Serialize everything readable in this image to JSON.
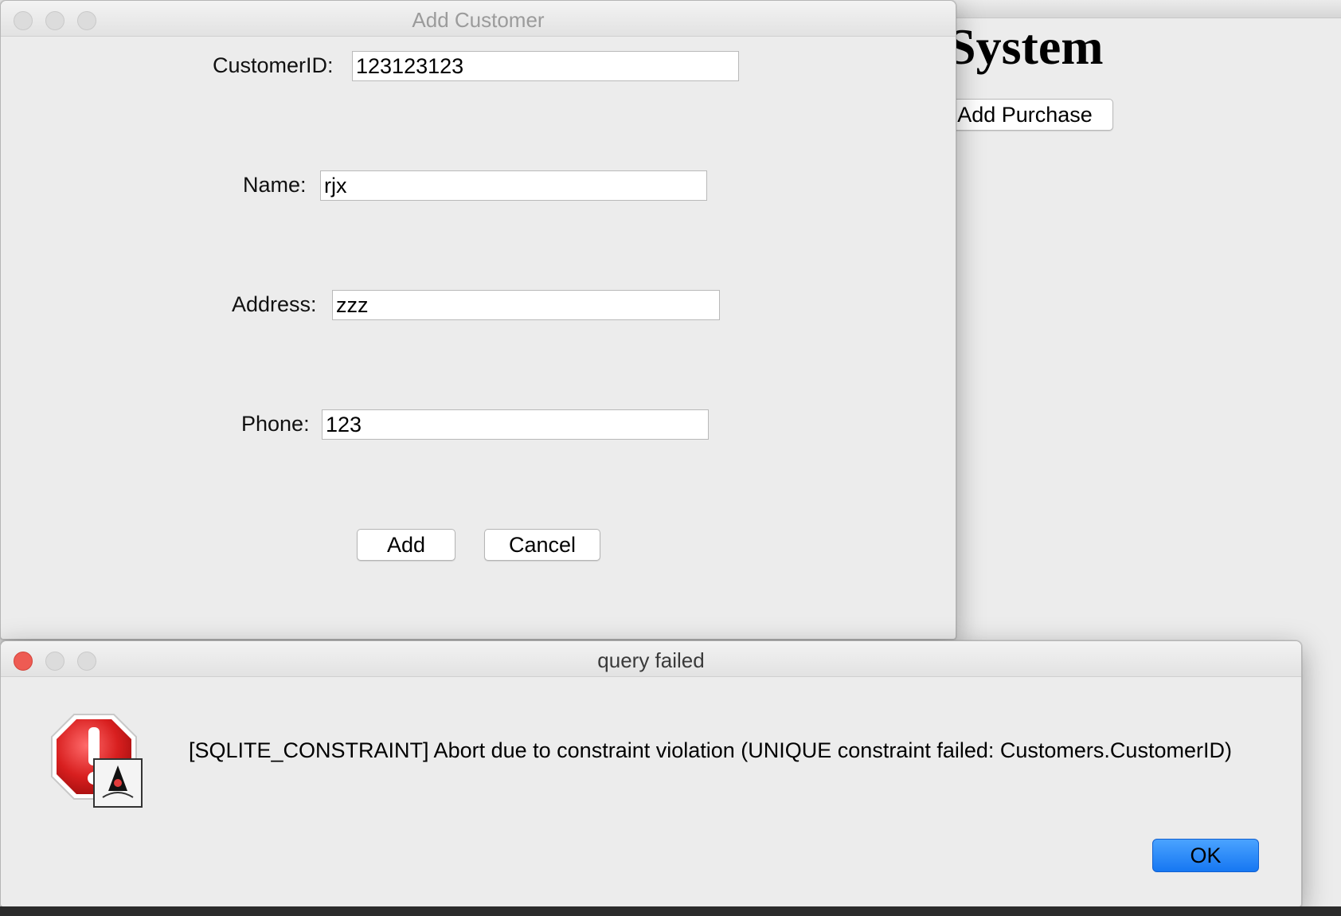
{
  "background_window": {
    "heading": "System",
    "add_purchase_label": "Add Purchase"
  },
  "add_customer_dialog": {
    "title": "Add Customer",
    "fields": {
      "customer_id": {
        "label": "CustomerID:",
        "value": "123123123"
      },
      "name": {
        "label": "Name:",
        "value": "rjx"
      },
      "address": {
        "label": "Address:",
        "value": "zzz"
      },
      "phone": {
        "label": "Phone:",
        "value": "123"
      }
    },
    "add_label": "Add",
    "cancel_label": "Cancel"
  },
  "error_dialog": {
    "title": "query failed",
    "message": "[SQLITE_CONSTRAINT]  Abort due to constraint violation (UNIQUE constraint failed: Customers.CustomerID)",
    "ok_label": "OK",
    "icon": "java-stop-warning-icon"
  },
  "colors": {
    "ok_button": "#1677f2",
    "close_button": "#ee5b53",
    "stop_sign": "#d81f1f"
  }
}
